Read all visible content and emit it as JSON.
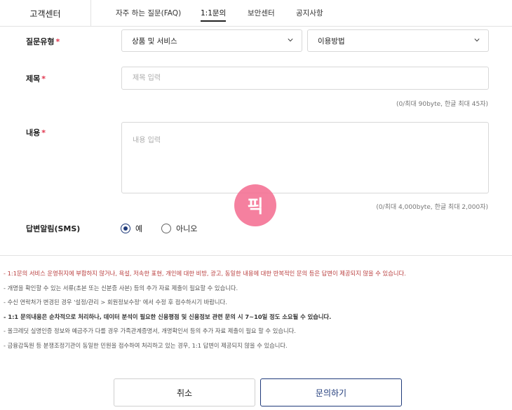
{
  "nav": {
    "home": "고객센터",
    "tabs": [
      {
        "label": "자주 하는 질문(FAQ)"
      },
      {
        "label": "1:1문의"
      },
      {
        "label": "보안센터"
      },
      {
        "label": "공지사항"
      }
    ],
    "active_tab": "1:1문의"
  },
  "form": {
    "type_label": "질문유형",
    "required_mark": "*",
    "type_select_1": "상품 및 서비스",
    "type_select_2": "이용방법",
    "title_label": "제목",
    "title_placeholder": "제목 입력",
    "title_counter": "(0/최대 90byte, 한글 최대 45자)",
    "content_label": "내용",
    "content_placeholder": "내용 입력",
    "content_counter": "(0/최대 4,000byte, 한글 최대 2,000자)",
    "sms_label": "답변알림(SMS)",
    "sms_yes": "예",
    "sms_no": "아니오",
    "sms_selected": "예"
  },
  "notices": [
    "1:1문의 서비스 운영취지에 부합하지 않거나, 욕설, 저속한 표현, 개인에 대한 비방, 광고, 동일한 내용에 대한 반복적인 문의 등은 답변이 제공되지 않을 수 있습니다.",
    "개명을 확인할 수 있는 서류(초본 또는 신분증 사본) 등의 추가 자료 제출이 필요할 수 있습니다.",
    "수신 연락처가 변경된 경우 '설정/관리 > 회원정보수정' 에서 수정 후 접수하시기 바랍니다.",
    "1:1 문의내용은 순차적으로 처리하나, 데이터 분석이 필요한 신용평점 및 신용정보 관련 문의 시 7~10일 정도 소요될 수 있습니다.",
    "올크레딧 실명인증 정보와 예금주가 다를 경우 가족관계증명서, 개명확인서 등의 추가 자료 제출이 필요 할 수 있습니다.",
    "금융감독원 등 분쟁조정기관이 동일한 민원을 접수하여 처리하고 있는 경우, 1:1 답변이 제공되지 않을 수 있습니다."
  ],
  "buttons": {
    "cancel": "취소",
    "submit": "문의하기"
  },
  "badge": {
    "text": "픽",
    "color": "#f46f92"
  },
  "colors": {
    "accent": "#1f3a7a",
    "required": "#e0344c",
    "notice_warning": "#b83b3b"
  }
}
